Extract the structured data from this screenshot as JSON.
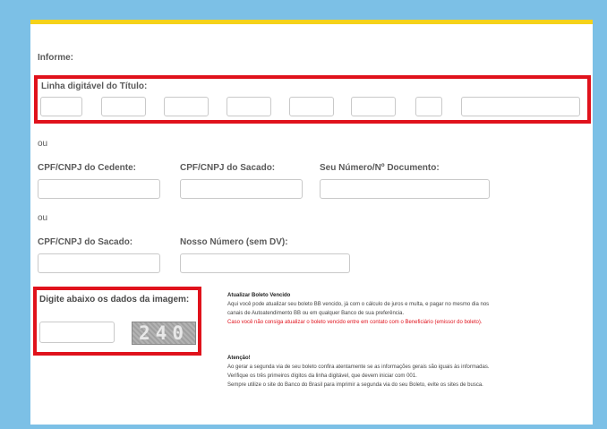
{
  "form": {
    "intro": "Informe:",
    "linha_label": "Linha digitável do Título:",
    "ou1": "ou",
    "cedente_label": "CPF/CNPJ do Cedente:",
    "sacado_label": "CPF/CNPJ do Sacado:",
    "documento_label": "Seu Número/Nº Documento:",
    "ou2": "ou",
    "sacado2_label": "CPF/CNPJ do Sacado:",
    "nosso_numero_label": "Nosso Número (sem DV):",
    "captcha_label": "Digite abaixo os dados da imagem:",
    "captcha_text": "240"
  },
  "notes": {
    "vencido_title": "Atualizar Boleto Vencido",
    "vencido_line1": "Aqui você pode atualizar seu boleto BB vencido, já com o cálculo de juros e multa, e pagar no mesmo dia nos",
    "vencido_line2": "canais de Autoatendimento BB ou em qualquer Banco de sua preferência.",
    "vencido_red": "Caso você não consiga atualizar o boleto vencido entre em contato com o Beneficiário (emissor do boleto).",
    "atencao_title": "Atenção!",
    "atencao_line1": "Ao gerar a segunda via de seu boleto confira atentamente se as informações gerais são iguais às informadas.",
    "atencao_line2": "Verifique os três primeiros dígitos da linha digitável, que devem iniciar com 001.",
    "atencao_line3": "Sempre utilize o site do Banco do Brasil para imprimir a segunda via do seu Boleto, evite os sites de busca."
  },
  "colors": {
    "background": "#7cc0e6",
    "top_bar": "#f5d21a",
    "highlight": "#e0121c"
  }
}
